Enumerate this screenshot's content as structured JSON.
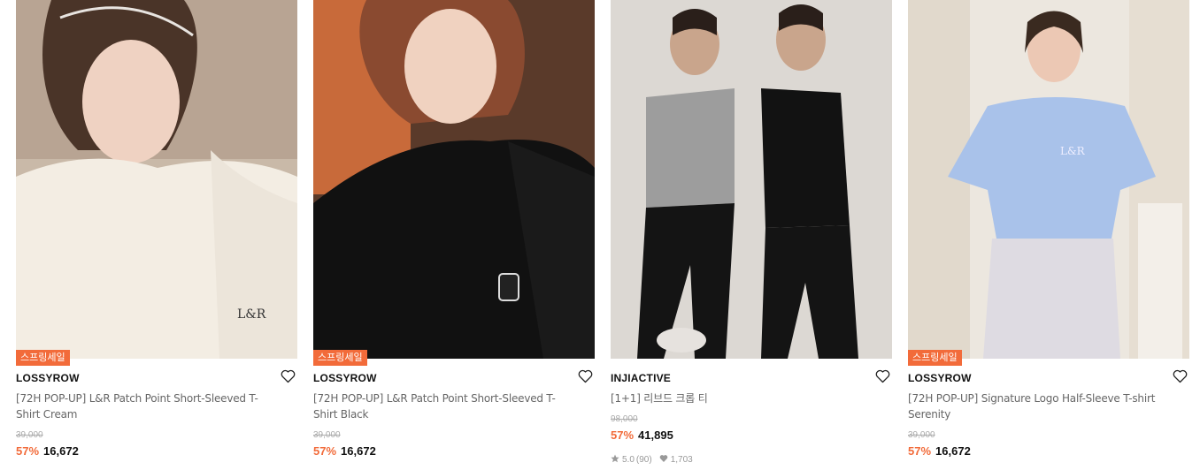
{
  "products": [
    {
      "badge": "스프링세일",
      "brand": "LOSSYROW",
      "name": "[72H POP-UP] L&R Patch Point Short-Sleeved T-Shirt Cream",
      "original_price": "39,000",
      "discount": "57%",
      "sale_price": "16,672",
      "image": "model-cream-tshirt-photo"
    },
    {
      "badge": "스프링세일",
      "brand": "LOSSYROW",
      "name": "[72H POP-UP] L&R Patch Point Short-Sleeved T-Shirt Black",
      "original_price": "39,000",
      "discount": "57%",
      "sale_price": "16,672",
      "image": "model-black-tshirt-photo"
    },
    {
      "brand": "INJIACTIVE",
      "name": "[1+1] 리브드 크롭 티",
      "original_price": "98,000",
      "discount": "57%",
      "sale_price": "41,895",
      "rating": "5.0",
      "review_count": "(90)",
      "likes": "1,703",
      "image": "two-models-crop-top-photo"
    },
    {
      "badge": "스프링세일",
      "brand": "LOSSYROW",
      "name": "[72H POP-UP] Signature Logo Half-Sleeve T-shirt Serenity",
      "original_price": "39,000",
      "discount": "57%",
      "sale_price": "16,672",
      "image": "model-blue-tshirt-photo"
    }
  ],
  "colors": {
    "accent": "#f26b3a",
    "text": "#111111",
    "muted": "#666666",
    "strike": "#aaaaaa"
  },
  "icons": [
    "heart-icon",
    "star-icon"
  ]
}
